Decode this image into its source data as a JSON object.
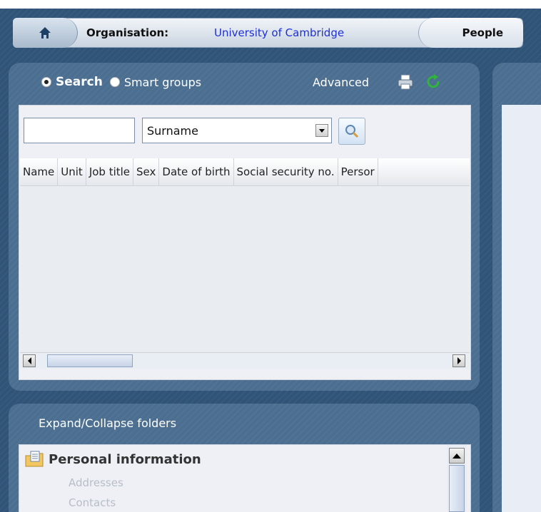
{
  "breadcrumb": {
    "home_icon": "home-icon",
    "org_label": "Organisation:",
    "org_value": "University of Cambridge",
    "current": "People"
  },
  "search_panel": {
    "mode_search": "Search",
    "mode_smart_groups": "Smart groups",
    "advanced": "Advanced",
    "search_value": "",
    "field_select": "Surname",
    "columns": [
      "Name",
      "Unit",
      "Job title",
      "Sex",
      "Date of birth",
      "Social security no.",
      "Persor"
    ]
  },
  "folders_panel": {
    "toggle_label": "Expand/Collapse folders",
    "folder_title": "Personal information",
    "items": [
      "Addresses",
      "Contacts"
    ]
  },
  "colors": {
    "background": "#2f5478",
    "panel": "#4c6f91",
    "link": "#1f2fd6"
  }
}
